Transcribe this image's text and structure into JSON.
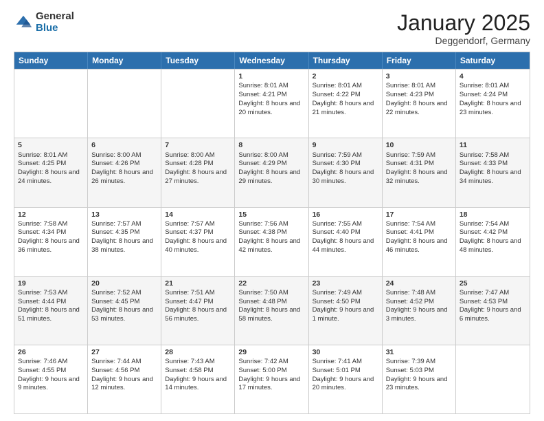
{
  "logo": {
    "general": "General",
    "blue": "Blue"
  },
  "header": {
    "month": "January 2025",
    "location": "Deggendorf, Germany"
  },
  "days": [
    "Sunday",
    "Monday",
    "Tuesday",
    "Wednesday",
    "Thursday",
    "Friday",
    "Saturday"
  ],
  "weeks": [
    [
      {
        "day": "",
        "sunrise": "",
        "sunset": "",
        "daylight": ""
      },
      {
        "day": "",
        "sunrise": "",
        "sunset": "",
        "daylight": ""
      },
      {
        "day": "",
        "sunrise": "",
        "sunset": "",
        "daylight": ""
      },
      {
        "day": "1",
        "sunrise": "Sunrise: 8:01 AM",
        "sunset": "Sunset: 4:21 PM",
        "daylight": "Daylight: 8 hours and 20 minutes."
      },
      {
        "day": "2",
        "sunrise": "Sunrise: 8:01 AM",
        "sunset": "Sunset: 4:22 PM",
        "daylight": "Daylight: 8 hours and 21 minutes."
      },
      {
        "day": "3",
        "sunrise": "Sunrise: 8:01 AM",
        "sunset": "Sunset: 4:23 PM",
        "daylight": "Daylight: 8 hours and 22 minutes."
      },
      {
        "day": "4",
        "sunrise": "Sunrise: 8:01 AM",
        "sunset": "Sunset: 4:24 PM",
        "daylight": "Daylight: 8 hours and 23 minutes."
      }
    ],
    [
      {
        "day": "5",
        "sunrise": "Sunrise: 8:01 AM",
        "sunset": "Sunset: 4:25 PM",
        "daylight": "Daylight: 8 hours and 24 minutes."
      },
      {
        "day": "6",
        "sunrise": "Sunrise: 8:00 AM",
        "sunset": "Sunset: 4:26 PM",
        "daylight": "Daylight: 8 hours and 26 minutes."
      },
      {
        "day": "7",
        "sunrise": "Sunrise: 8:00 AM",
        "sunset": "Sunset: 4:28 PM",
        "daylight": "Daylight: 8 hours and 27 minutes."
      },
      {
        "day": "8",
        "sunrise": "Sunrise: 8:00 AM",
        "sunset": "Sunset: 4:29 PM",
        "daylight": "Daylight: 8 hours and 29 minutes."
      },
      {
        "day": "9",
        "sunrise": "Sunrise: 7:59 AM",
        "sunset": "Sunset: 4:30 PM",
        "daylight": "Daylight: 8 hours and 30 minutes."
      },
      {
        "day": "10",
        "sunrise": "Sunrise: 7:59 AM",
        "sunset": "Sunset: 4:31 PM",
        "daylight": "Daylight: 8 hours and 32 minutes."
      },
      {
        "day": "11",
        "sunrise": "Sunrise: 7:58 AM",
        "sunset": "Sunset: 4:33 PM",
        "daylight": "Daylight: 8 hours and 34 minutes."
      }
    ],
    [
      {
        "day": "12",
        "sunrise": "Sunrise: 7:58 AM",
        "sunset": "Sunset: 4:34 PM",
        "daylight": "Daylight: 8 hours and 36 minutes."
      },
      {
        "day": "13",
        "sunrise": "Sunrise: 7:57 AM",
        "sunset": "Sunset: 4:35 PM",
        "daylight": "Daylight: 8 hours and 38 minutes."
      },
      {
        "day": "14",
        "sunrise": "Sunrise: 7:57 AM",
        "sunset": "Sunset: 4:37 PM",
        "daylight": "Daylight: 8 hours and 40 minutes."
      },
      {
        "day": "15",
        "sunrise": "Sunrise: 7:56 AM",
        "sunset": "Sunset: 4:38 PM",
        "daylight": "Daylight: 8 hours and 42 minutes."
      },
      {
        "day": "16",
        "sunrise": "Sunrise: 7:55 AM",
        "sunset": "Sunset: 4:40 PM",
        "daylight": "Daylight: 8 hours and 44 minutes."
      },
      {
        "day": "17",
        "sunrise": "Sunrise: 7:54 AM",
        "sunset": "Sunset: 4:41 PM",
        "daylight": "Daylight: 8 hours and 46 minutes."
      },
      {
        "day": "18",
        "sunrise": "Sunrise: 7:54 AM",
        "sunset": "Sunset: 4:42 PM",
        "daylight": "Daylight: 8 hours and 48 minutes."
      }
    ],
    [
      {
        "day": "19",
        "sunrise": "Sunrise: 7:53 AM",
        "sunset": "Sunset: 4:44 PM",
        "daylight": "Daylight: 8 hours and 51 minutes."
      },
      {
        "day": "20",
        "sunrise": "Sunrise: 7:52 AM",
        "sunset": "Sunset: 4:45 PM",
        "daylight": "Daylight: 8 hours and 53 minutes."
      },
      {
        "day": "21",
        "sunrise": "Sunrise: 7:51 AM",
        "sunset": "Sunset: 4:47 PM",
        "daylight": "Daylight: 8 hours and 56 minutes."
      },
      {
        "day": "22",
        "sunrise": "Sunrise: 7:50 AM",
        "sunset": "Sunset: 4:48 PM",
        "daylight": "Daylight: 8 hours and 58 minutes."
      },
      {
        "day": "23",
        "sunrise": "Sunrise: 7:49 AM",
        "sunset": "Sunset: 4:50 PM",
        "daylight": "Daylight: 9 hours and 1 minute."
      },
      {
        "day": "24",
        "sunrise": "Sunrise: 7:48 AM",
        "sunset": "Sunset: 4:52 PM",
        "daylight": "Daylight: 9 hours and 3 minutes."
      },
      {
        "day": "25",
        "sunrise": "Sunrise: 7:47 AM",
        "sunset": "Sunset: 4:53 PM",
        "daylight": "Daylight: 9 hours and 6 minutes."
      }
    ],
    [
      {
        "day": "26",
        "sunrise": "Sunrise: 7:46 AM",
        "sunset": "Sunset: 4:55 PM",
        "daylight": "Daylight: 9 hours and 9 minutes."
      },
      {
        "day": "27",
        "sunrise": "Sunrise: 7:44 AM",
        "sunset": "Sunset: 4:56 PM",
        "daylight": "Daylight: 9 hours and 12 minutes."
      },
      {
        "day": "28",
        "sunrise": "Sunrise: 7:43 AM",
        "sunset": "Sunset: 4:58 PM",
        "daylight": "Daylight: 9 hours and 14 minutes."
      },
      {
        "day": "29",
        "sunrise": "Sunrise: 7:42 AM",
        "sunset": "Sunset: 5:00 PM",
        "daylight": "Daylight: 9 hours and 17 minutes."
      },
      {
        "day": "30",
        "sunrise": "Sunrise: 7:41 AM",
        "sunset": "Sunset: 5:01 PM",
        "daylight": "Daylight: 9 hours and 20 minutes."
      },
      {
        "day": "31",
        "sunrise": "Sunrise: 7:39 AM",
        "sunset": "Sunset: 5:03 PM",
        "daylight": "Daylight: 9 hours and 23 minutes."
      },
      {
        "day": "",
        "sunrise": "",
        "sunset": "",
        "daylight": ""
      }
    ]
  ]
}
